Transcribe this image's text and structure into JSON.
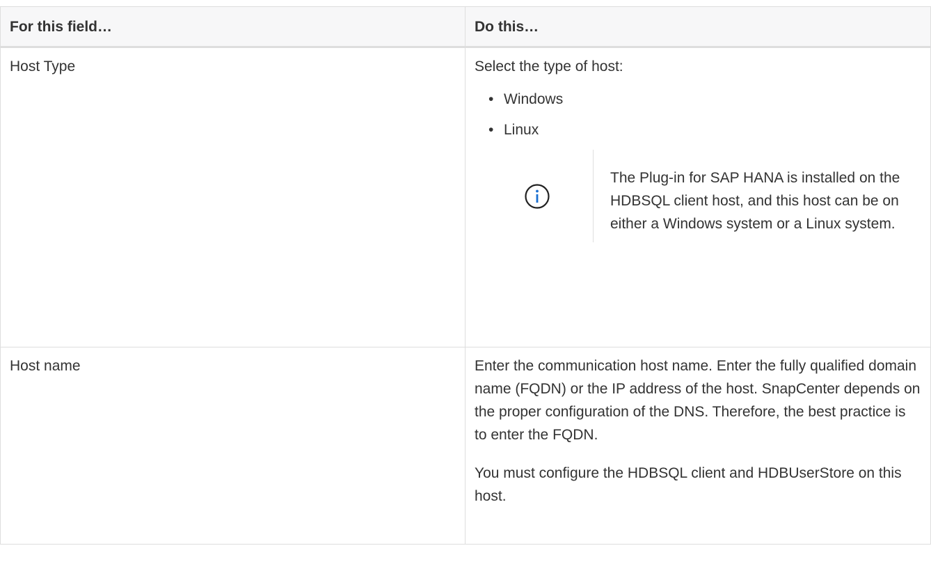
{
  "table": {
    "headers": {
      "field": "For this field…",
      "action": "Do this…"
    },
    "rows": [
      {
        "field": "Host Type",
        "intro": "Select the type of host:",
        "options": [
          "Windows",
          "Linux"
        ],
        "note": "The Plug-in for SAP HANA is installed on the HDBSQL client host, and this host can be on either a Windows system or a Linux system."
      },
      {
        "field": "Host name",
        "paragraphs": [
          "Enter the communication host name. Enter the fully qualified domain name (FQDN) or the IP address of the host. SnapCenter depends on the proper configuration of the DNS. Therefore, the best practice is to enter the FQDN.",
          "You must configure the HDBSQL client and HDBUserStore on this host."
        ]
      }
    ]
  },
  "colors": {
    "info_icon": "#1a6fd1",
    "border": "#dedede",
    "header_bg": "#f7f7f8",
    "text": "#333333"
  },
  "icons": {
    "note": "info-circle-icon"
  }
}
